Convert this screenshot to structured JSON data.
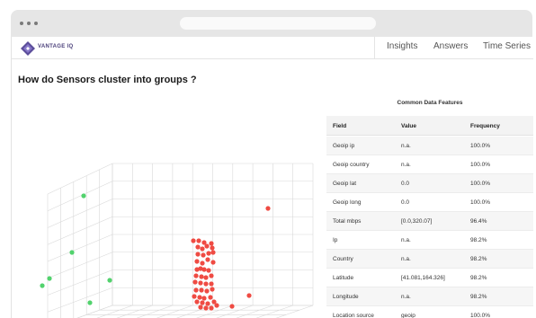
{
  "app": {
    "brand": "VANTAGE IQ",
    "nav": [
      "Insights",
      "Answers",
      "Time Series"
    ],
    "question": "How do Sensors cluster into groups ?"
  },
  "table": {
    "title": "Common Data Features",
    "headers": [
      "Field",
      "Value",
      "Frequency"
    ],
    "rows": [
      [
        "Geoip ip",
        "n.a.",
        "100.0%"
      ],
      [
        "Geoip country",
        "n.a.",
        "100.0%"
      ],
      [
        "Geoip lat",
        "0.0",
        "100.0%"
      ],
      [
        "Geoip long",
        "0.0",
        "100.0%"
      ],
      [
        "Total mbps",
        "[0.0,320.07]",
        "96.4%"
      ],
      [
        "Ip",
        "n.a.",
        "98.2%"
      ],
      [
        "Country",
        "n.a.",
        "98.2%"
      ],
      [
        "Latitude",
        "[41.081,164.326]",
        "98.2%"
      ],
      [
        "Longitude",
        "n.a.",
        "98.2%"
      ],
      [
        "Location source",
        "geoip",
        "100.0%"
      ]
    ]
  },
  "chart_data": {
    "type": "scatter",
    "projection": "3d",
    "grid": true,
    "series": [
      {
        "color": "#ef4b43",
        "points": [
          [
            202,
            227
          ],
          [
            208,
            227
          ],
          [
            214,
            229
          ],
          [
            222,
            230
          ],
          [
            207,
            234
          ],
          [
            212,
            236
          ],
          [
            217,
            233
          ],
          [
            223,
            235
          ],
          [
            207,
            242
          ],
          [
            213,
            243
          ],
          [
            219,
            241
          ],
          [
            224,
            240
          ],
          [
            206,
            250
          ],
          [
            212,
            252
          ],
          [
            218,
            248
          ],
          [
            224,
            251
          ],
          [
            206,
            259
          ],
          [
            210,
            258
          ],
          [
            214,
            259
          ],
          [
            219,
            260
          ],
          [
            205,
            266
          ],
          [
            211,
            267
          ],
          [
            216,
            268
          ],
          [
            222,
            266
          ],
          [
            204,
            273
          ],
          [
            210,
            274
          ],
          [
            216,
            275
          ],
          [
            222,
            275
          ],
          [
            205,
            282
          ],
          [
            211,
            282
          ],
          [
            217,
            283
          ],
          [
            223,
            281
          ],
          [
            203,
            289
          ],
          [
            209,
            290
          ],
          [
            214,
            291
          ],
          [
            221,
            290
          ],
          [
            206,
            295
          ],
          [
            212,
            296
          ],
          [
            218,
            297
          ],
          [
            225,
            295
          ],
          [
            210,
            301
          ],
          [
            216,
            302
          ],
          [
            222,
            302
          ],
          [
            228,
            299
          ],
          [
            245,
            300
          ],
          [
            264,
            288
          ],
          [
            285,
            191
          ]
        ]
      },
      {
        "color": "#52d26d",
        "points": [
          [
            80,
            177
          ],
          [
            67,
            240
          ],
          [
            42,
            269
          ],
          [
            34,
            277
          ],
          [
            109,
            271
          ],
          [
            87,
            296
          ]
        ]
      }
    ]
  }
}
